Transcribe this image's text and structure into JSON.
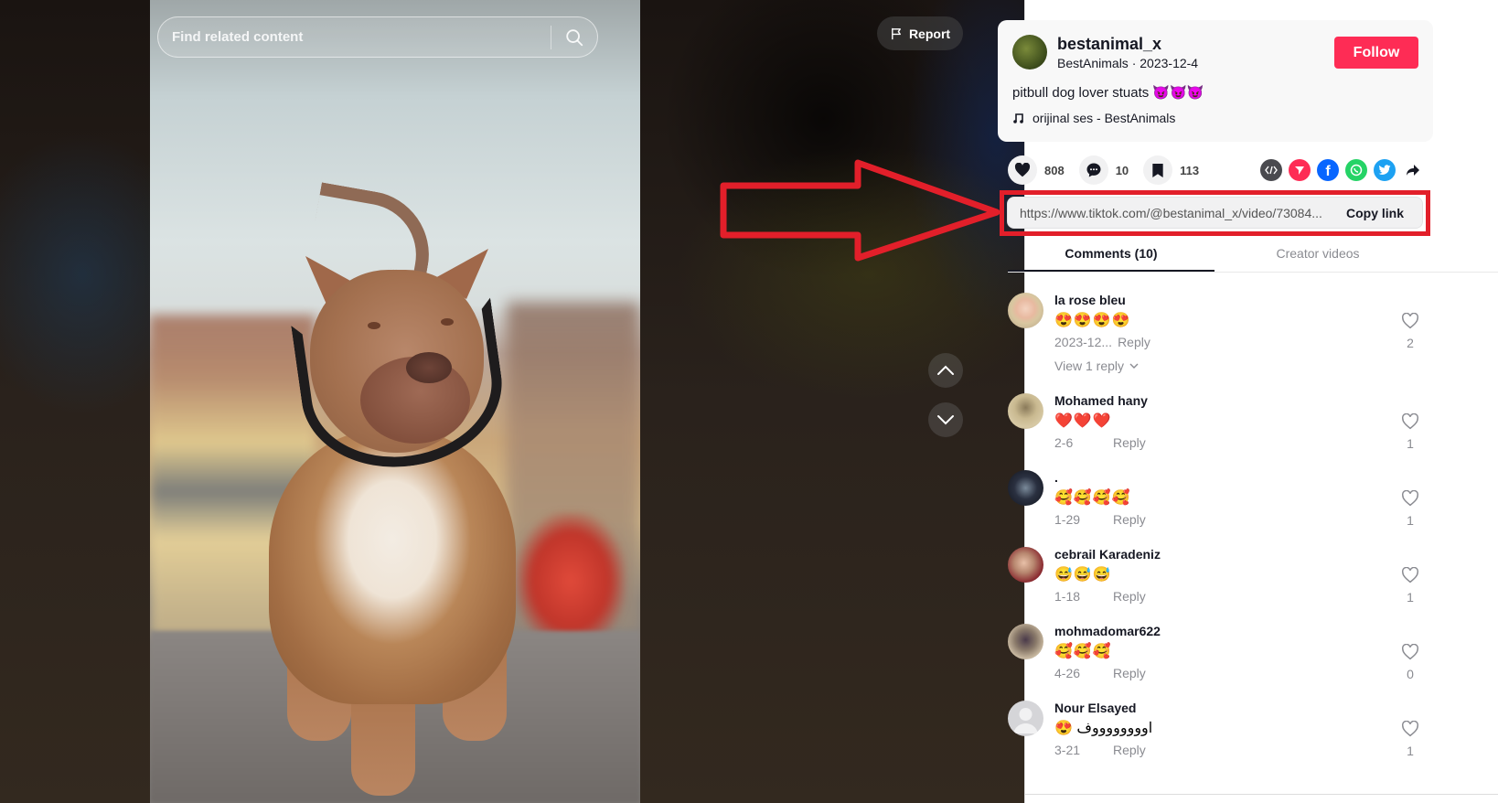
{
  "video": {
    "search_placeholder": "Find related content",
    "report_label": "Report"
  },
  "author": {
    "username": "bestanimal_x",
    "display_name": "BestAnimals",
    "date": "2023-12-4",
    "follow_label": "Follow",
    "caption": "pitbull dog lover stuats",
    "caption_emojis": "😈😈😈",
    "music": "orijinal ses - BestAnimals"
  },
  "stats": {
    "likes": "808",
    "comments": "10",
    "saves": "113"
  },
  "share_icons": [
    "embed-icon",
    "send-to-friends-icon",
    "facebook-icon",
    "whatsapp-icon",
    "twitter-icon",
    "share-arrow-icon"
  ],
  "link": {
    "url": "https://www.tiktok.com/@bestanimal_x/video/73084...",
    "copy_label": "Copy link"
  },
  "tabs": [
    {
      "label": "Comments (10)",
      "active": true
    },
    {
      "label": "Creator videos",
      "active": false
    }
  ],
  "comments": [
    {
      "name": "la rose bleu",
      "text": "😍😍😍😍",
      "date": "2023-12...",
      "reply": "Reply",
      "likes": "2",
      "view_replies": "View 1 reply"
    },
    {
      "name": "Mohamed hany",
      "text": "❤️❤️❤️",
      "date": "2-6",
      "reply": "Reply",
      "likes": "1"
    },
    {
      "name": ".",
      "text": "🥰🥰🥰🥰",
      "date": "1-29",
      "reply": "Reply",
      "likes": "1"
    },
    {
      "name": "cebrail Karadeniz",
      "text": "😅😅😅",
      "date": "1-18",
      "reply": "Reply",
      "likes": "1"
    },
    {
      "name": "mohmadomar622",
      "text": "🥰🥰🥰",
      "date": "4-26",
      "reply": "Reply",
      "likes": "0"
    },
    {
      "name": "Nour Elsayed",
      "text": "😍 اووووووووف",
      "date": "3-21",
      "reply": "Reply",
      "likes": "1"
    }
  ],
  "colors": {
    "follow": "#fe2c55",
    "annotation": "#e21f2a"
  }
}
